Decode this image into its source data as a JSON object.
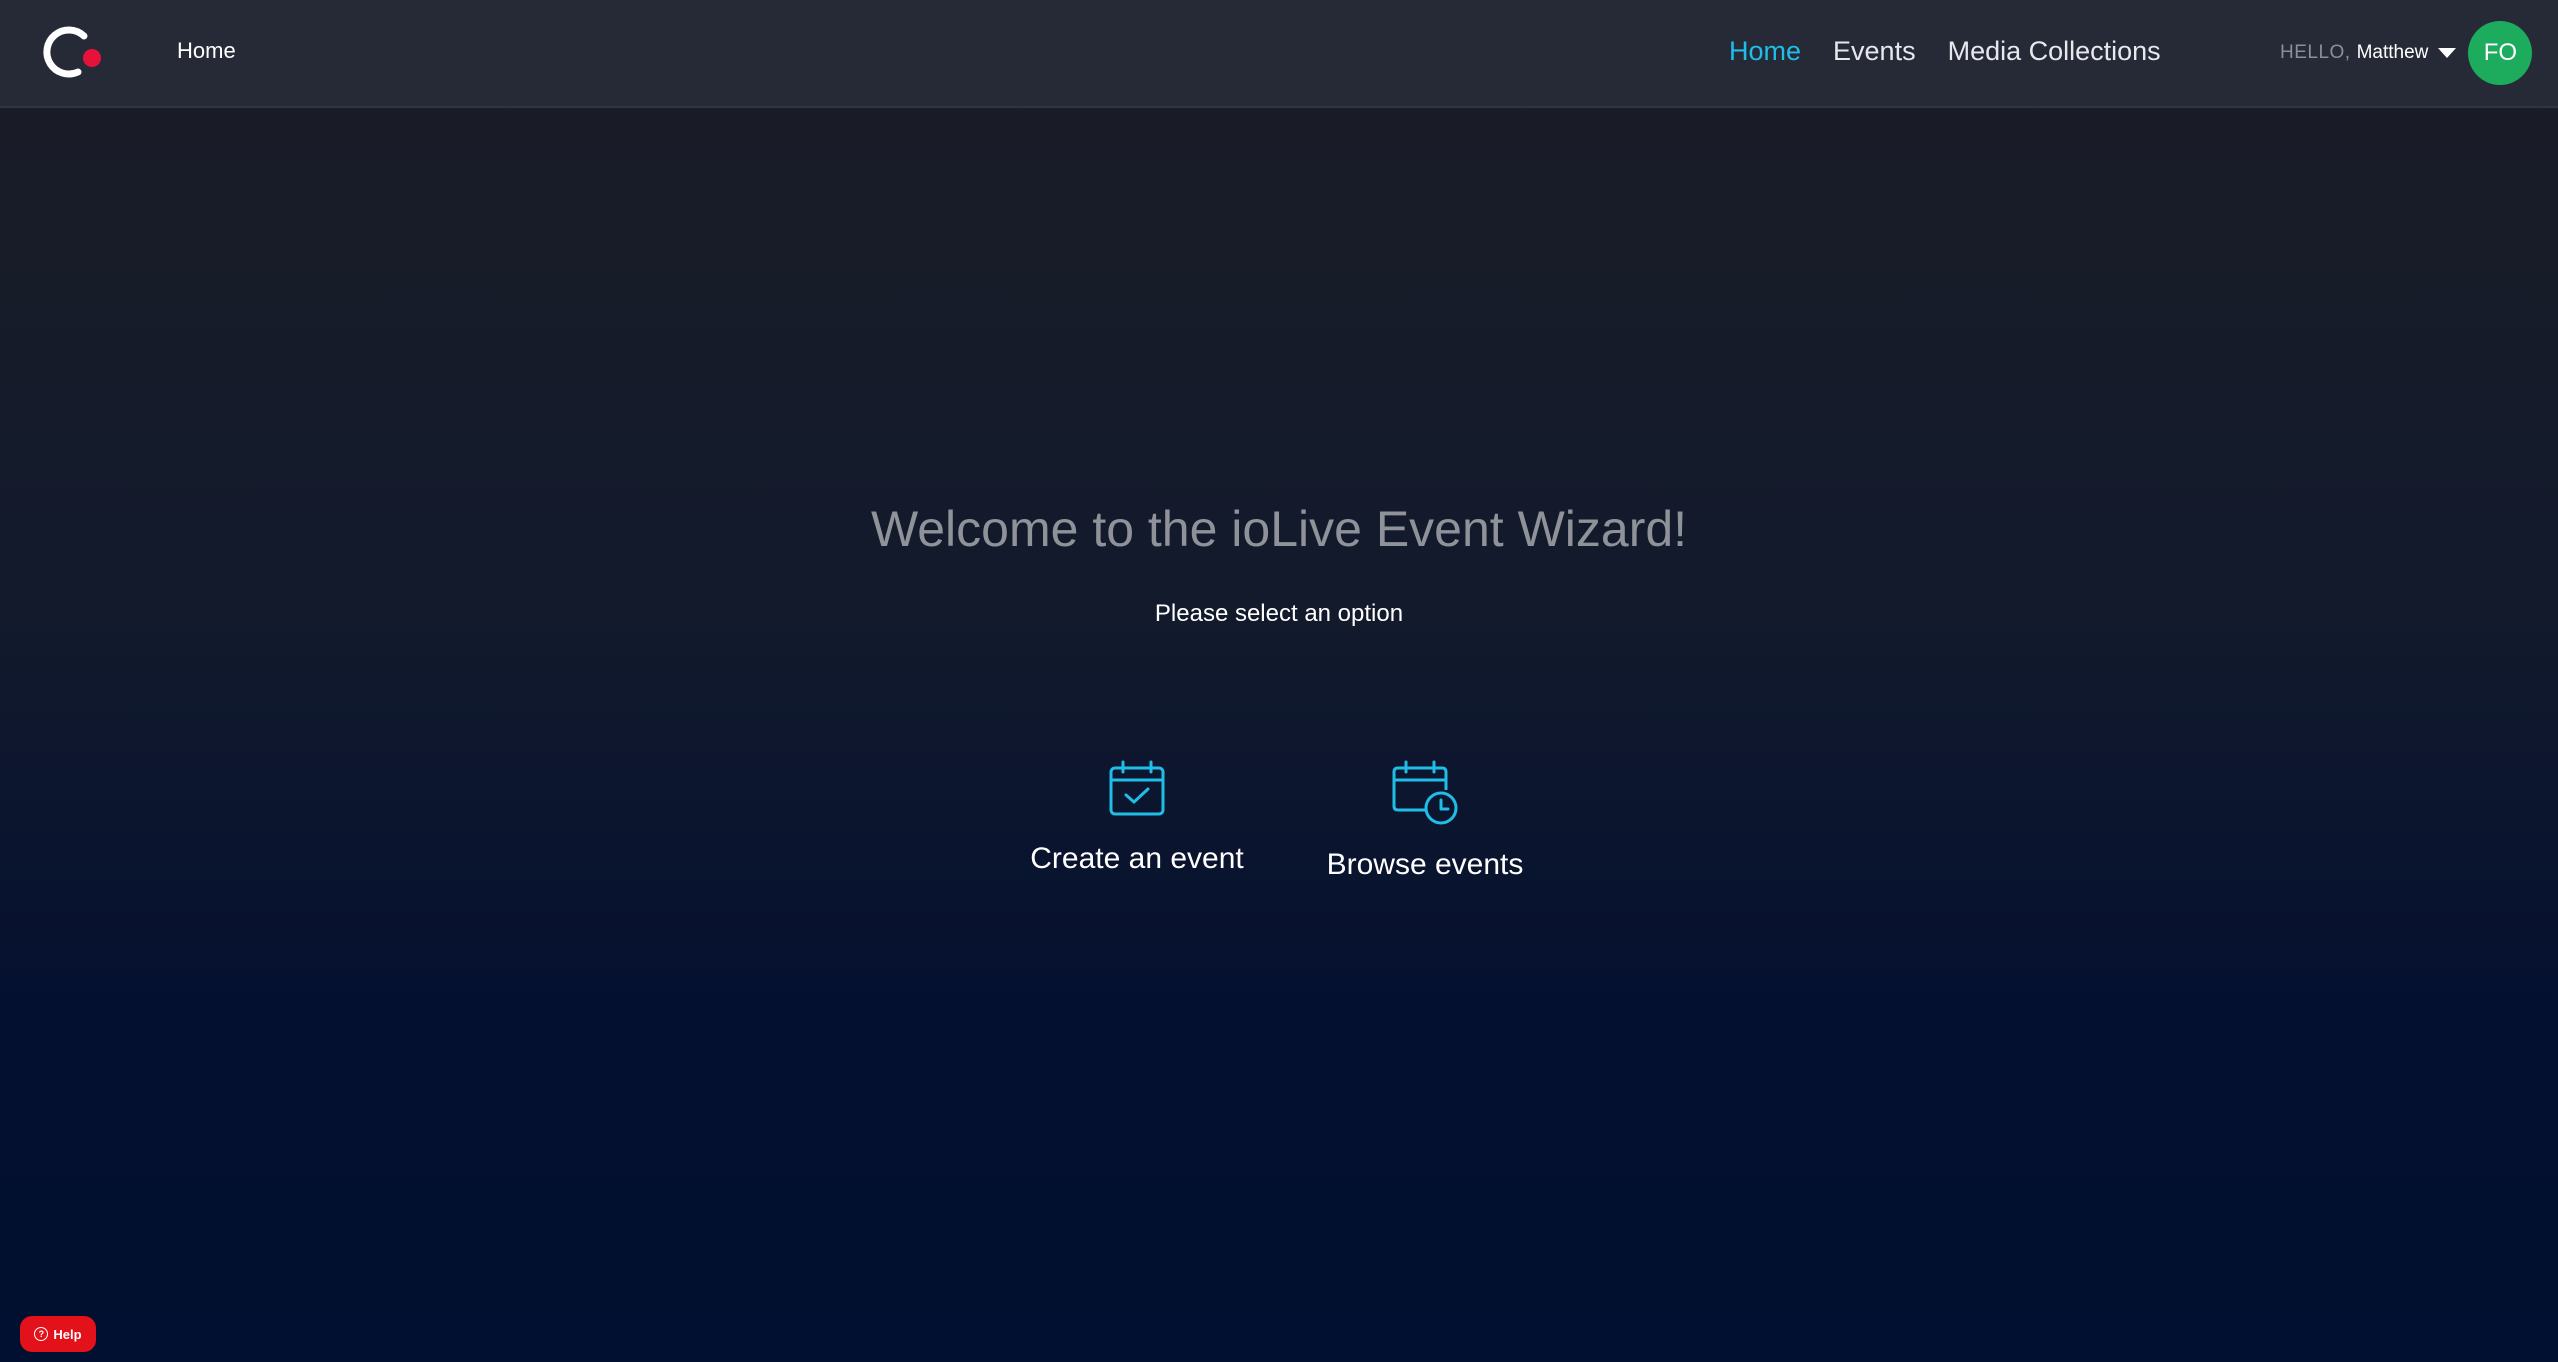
{
  "header": {
    "breadcrumb": "Home",
    "nav": [
      {
        "label": "Home",
        "active": true
      },
      {
        "label": "Events",
        "active": false
      },
      {
        "label": "Media Collections",
        "active": false
      }
    ],
    "user": {
      "greeting": "HELLO,",
      "name": "Matthew",
      "avatar_initials": "FO",
      "avatar_color": "#1dab5e"
    }
  },
  "main": {
    "title": "Welcome to the ioLive Event Wizard!",
    "subtitle": "Please select an option",
    "options": [
      {
        "label": "Create an event",
        "icon": "calendar-check-icon"
      },
      {
        "label": "Browse events",
        "icon": "calendar-clock-icon"
      }
    ]
  },
  "help": {
    "label": "Help",
    "icon": "question-icon",
    "color": "#e3111a"
  },
  "colors": {
    "accent": "#1fbde8",
    "logo_dot": "#e5133b"
  }
}
